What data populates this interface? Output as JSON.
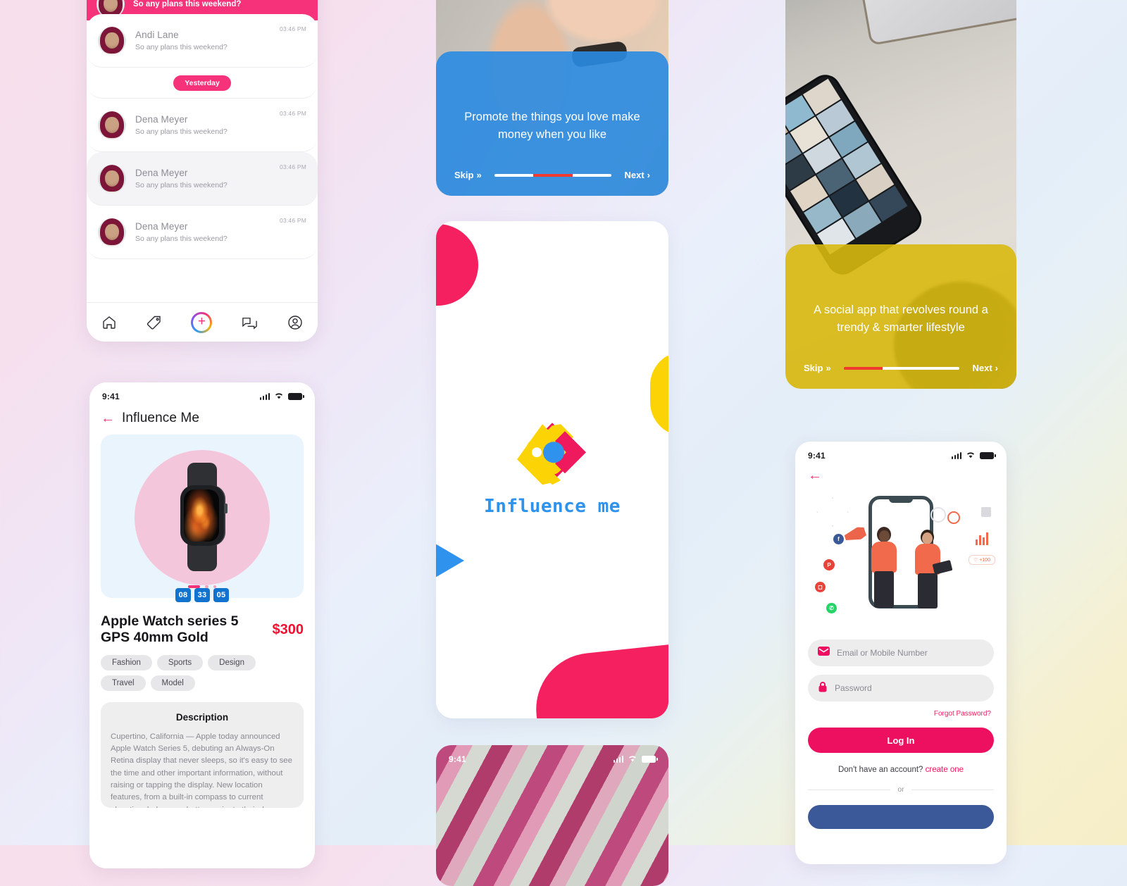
{
  "background": {
    "gradient_start": "#f6dced",
    "gradient_mid": "#e2ecf8",
    "gradient_end": "#f4efcf"
  },
  "brand": {
    "pink": "#f5327a",
    "blue": "#2f93ee",
    "yellow": "#fcd406",
    "red": "#f01030"
  },
  "chat_screen": {
    "header": {
      "name": "",
      "preview": "So any plans this weekend?"
    },
    "day_divider": "Yesterday",
    "rows": [
      {
        "name": "Andi Lane",
        "preview": "So any plans this weekend?",
        "time": "03:46 PM",
        "active": false
      },
      {
        "name": "Dena Meyer",
        "preview": "So any plans this weekend?",
        "time": "03:46 PM",
        "active": false
      },
      {
        "name": "Dena Meyer",
        "preview": "So any plans this weekend?",
        "time": "03:46 PM",
        "active": true
      },
      {
        "name": "Dena Meyer",
        "preview": "So any plans this weekend?",
        "time": "03:46 PM",
        "active": false
      }
    ],
    "tabs": [
      {
        "icon": "home-icon",
        "label": "Home"
      },
      {
        "icon": "tag-icon",
        "label": "Offers"
      },
      {
        "icon": "add-post-icon",
        "label": "Create"
      },
      {
        "icon": "chat-icon",
        "label": "Messages"
      },
      {
        "icon": "profile-icon",
        "label": "Profile"
      }
    ]
  },
  "product_screen": {
    "status_bar": {
      "time": "9:41"
    },
    "title": "Influence Me",
    "back_label": "Back",
    "carousel_dots": 3,
    "countdown": [
      "08",
      "33",
      "05"
    ],
    "product_name": "Apple Watch series 5 GPS 40mm Gold",
    "price": "$300",
    "tags": [
      "Fashion",
      "Sports",
      "Design",
      "Travel",
      "Model"
    ],
    "description": {
      "heading": "Description",
      "body": "Cupertino, California — Apple today announced Apple Watch Series 5, debuting an Always-On Retina display that never sleeps, so it's easy to see the time and other important information, without raising or tapping the display. New location features, from a built-in compass to current elevation, help users better navigate their day."
    }
  },
  "onboarding_blue": {
    "text": "Promote the things you love make money when you like",
    "skip_label": "Skip",
    "skip_glyph": "»",
    "next_label": "Next",
    "next_glyph": "›",
    "progress": {
      "steps": 3,
      "active_index": 1
    },
    "overlay_color": "#298be2"
  },
  "onboarding_yellow": {
    "text": "A social app that revolves round a trendy & smarter lifestyle",
    "skip_label": "Skip",
    "skip_glyph": "»",
    "next_label": "Next",
    "next_glyph": "›",
    "progress": {
      "steps": 3,
      "active_index": 0
    },
    "overlay_color": "#d8b910"
  },
  "splash_screen": {
    "wordmark": "Influence me",
    "logo_colors": {
      "left": "#fcd406",
      "right": "#ef1a5e",
      "center": "#2f93ee"
    }
  },
  "pink_photo_card": {
    "status_bar": {
      "time": "9:41"
    }
  },
  "login_screen": {
    "status_bar": {
      "time": "9:41"
    },
    "back_label": "Back",
    "email_placeholder": "Email or Mobile Number",
    "password_placeholder": "Password",
    "email_value": "",
    "password_value": "",
    "forgot_label": "Forgot Password?",
    "login_button": "Log In",
    "no_account_text": "Don't have an account?",
    "create_one_label": "create one",
    "or_label": "or"
  }
}
